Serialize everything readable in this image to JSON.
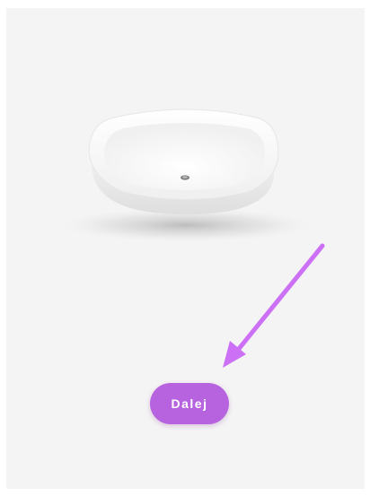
{
  "product": {
    "icon": "white-bathtub-basin-image"
  },
  "hint": {
    "icon": "arrow-pointer-icon",
    "color": "#cc70f6"
  },
  "actions": {
    "next_label": "Dalej",
    "button_color": "#b763df"
  },
  "colors": {
    "background": "#f5f4f4",
    "page": "#ffffff"
  }
}
